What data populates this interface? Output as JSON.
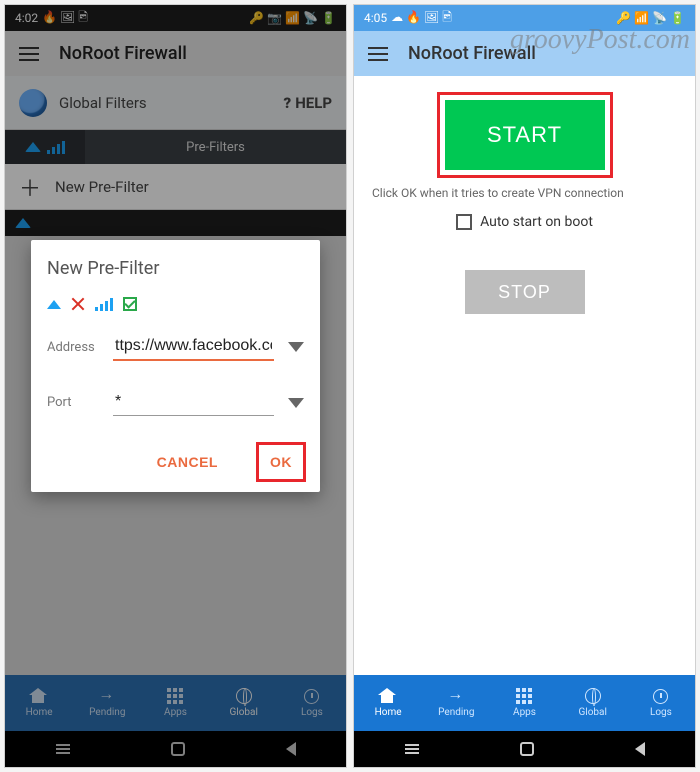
{
  "watermark": "groovyPost.com",
  "left": {
    "status": {
      "time": "4:02",
      "icons": "🔥 🖼 🖻",
      "right": "🔑 📷 📶 📡 🔋"
    },
    "appbar": {
      "title": "NoRoot Firewall"
    },
    "section": {
      "title": "Global Filters",
      "help_label": "HELP"
    },
    "tab": {
      "label": "Pre-Filters"
    },
    "new_filter_label": "New Pre-Filter",
    "dialog": {
      "title": "New Pre-Filter",
      "address_label": "Address",
      "address_value": "ttps://www.facebook.com/",
      "port_label": "Port",
      "port_value": "*",
      "cancel_label": "CANCEL",
      "ok_label": "OK"
    },
    "nav": {
      "home": "Home",
      "pending": "Pending",
      "apps": "Apps",
      "global": "Global",
      "logs": "Logs"
    }
  },
  "right": {
    "status": {
      "time": "4:05",
      "icons": "☁ 🔥 🖼 🖻",
      "right": "🔑 📶 📡 🔋"
    },
    "appbar": {
      "title": "NoRoot Firewall"
    },
    "start_label": "START",
    "hint": "Click OK when it tries to create VPN connection",
    "autostart_label": "Auto start on boot",
    "stop_label": "STOP",
    "nav": {
      "home": "Home",
      "pending": "Pending",
      "apps": "Apps",
      "global": "Global",
      "logs": "Logs"
    }
  }
}
